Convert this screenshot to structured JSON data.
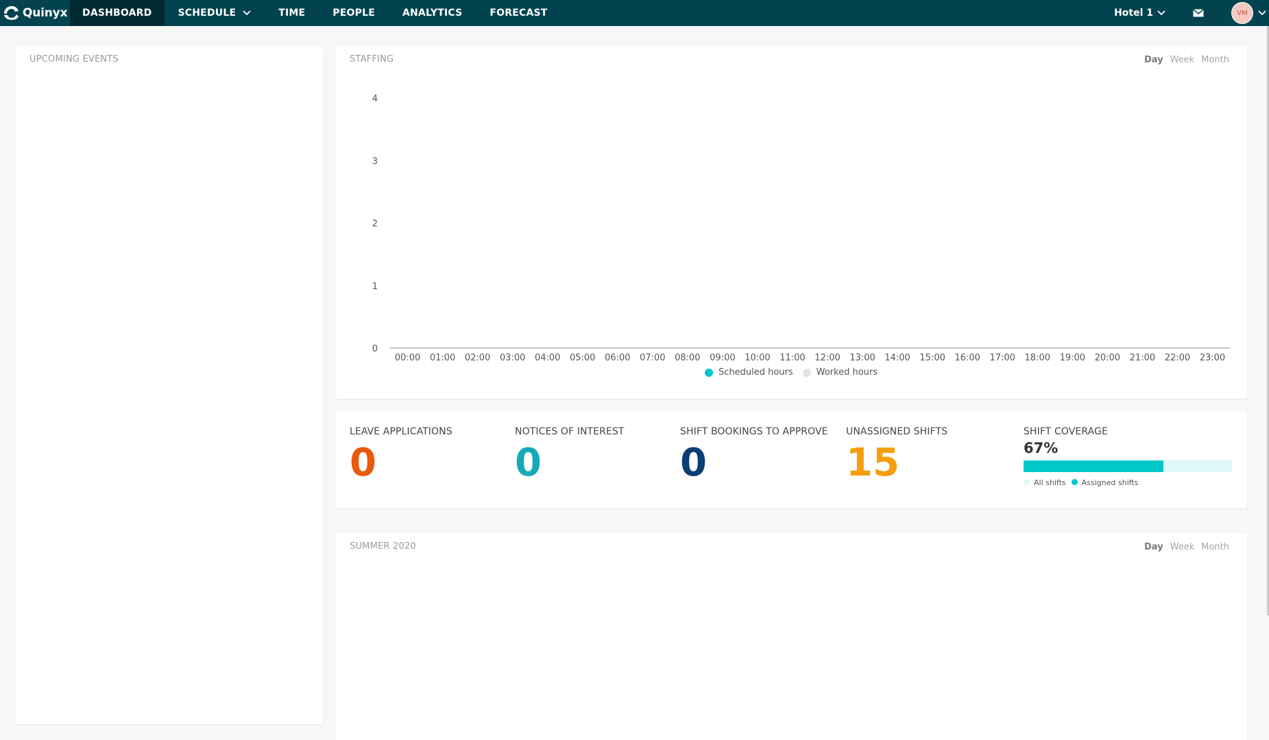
{
  "app": {
    "brand": "Quinyx"
  },
  "nav": {
    "items": [
      {
        "label": "DASHBOARD",
        "active": true
      },
      {
        "label": "SCHEDULE",
        "dropdown": true
      },
      {
        "label": "TIME"
      },
      {
        "label": "PEOPLE"
      },
      {
        "label": "ANALYTICS"
      },
      {
        "label": "FORECAST"
      }
    ],
    "site": "Hotel 1",
    "user_initials": "VM"
  },
  "events": {
    "title": "UPCOMING EVENTS"
  },
  "staffing": {
    "title": "STAFFING",
    "periods": [
      "Day",
      "Week",
      "Month"
    ],
    "active_period": "Day",
    "legend": [
      "Scheduled hours",
      "Worked hours"
    ]
  },
  "chart_data": {
    "type": "line",
    "x": [
      "00:00",
      "01:00",
      "02:00",
      "03:00",
      "04:00",
      "05:00",
      "06:00",
      "07:00",
      "08:00",
      "09:00",
      "10:00",
      "11:00",
      "12:00",
      "13:00",
      "14:00",
      "15:00",
      "16:00",
      "17:00",
      "18:00",
      "19:00",
      "20:00",
      "21:00",
      "22:00",
      "23:00"
    ],
    "series": [
      {
        "name": "Scheduled hours",
        "color": "#00c4cc",
        "values": [
          0,
          0,
          0,
          0,
          0,
          0,
          0,
          0,
          0,
          0,
          0,
          0,
          0,
          0,
          0,
          0,
          0,
          0,
          0,
          0,
          0,
          0,
          0,
          0
        ]
      },
      {
        "name": "Worked hours",
        "color": "#e2e2e2",
        "values": [
          0,
          0,
          0,
          0,
          0,
          0,
          0,
          0,
          0,
          0,
          0,
          0,
          0,
          0,
          0,
          0,
          0,
          0,
          0,
          0,
          0,
          0,
          0,
          0
        ]
      }
    ],
    "yticks": [
      0,
      1,
      2,
      3,
      4
    ],
    "ylim": [
      0,
      4
    ],
    "legend_position": "bottom"
  },
  "kpis": {
    "leave": {
      "label": "LEAVE APPLICATIONS",
      "value": "0",
      "color": "#e8590c"
    },
    "notices": {
      "label": "NOTICES OF INTEREST",
      "value": "0",
      "color": "#17a9b8"
    },
    "bookings": {
      "label": "SHIFT BOOKINGS TO APPROVE",
      "value": "0",
      "color": "#0b3e73"
    },
    "unassigned": {
      "label": "UNASSIGNED SHIFTS",
      "value": "15",
      "color": "#f59e0b"
    },
    "coverage": {
      "label": "SHIFT COVERAGE",
      "percent_text": "67%",
      "fraction": 0.67,
      "legend_all": "All shifts",
      "legend_assigned": "Assigned shifts",
      "color_all": "#dff7f8",
      "color_assigned": "#00c8c8"
    }
  },
  "summer": {
    "title": "SUMMER 2020",
    "periods": [
      "Day",
      "Week",
      "Month"
    ],
    "active_period": "Day"
  }
}
